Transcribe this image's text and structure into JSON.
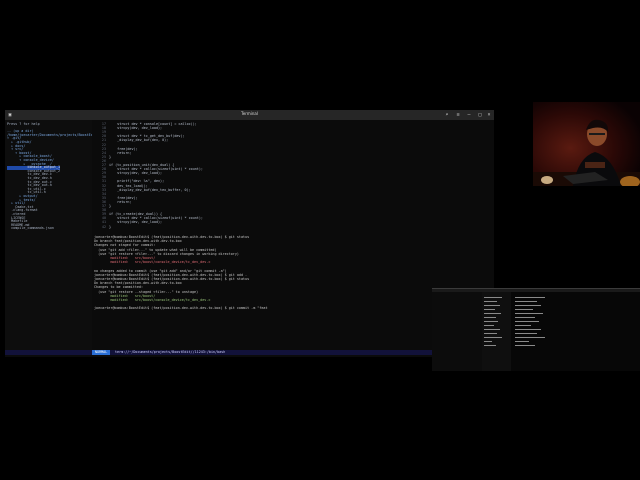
{
  "window": {
    "title": "Terminal"
  },
  "tree": {
    "items": [
      {
        "label": "Press ? for help",
        "kind": "file"
      },
      {
        "label": "",
        "kind": "file"
      },
      {
        "label": ".. (up a dir)",
        "kind": "dir"
      },
      {
        "label": "/home/joecarter/Documents/projects/BoostEdit/",
        "kind": "dir"
      },
      {
        "label": "▾ .git/",
        "kind": "dir"
      },
      {
        "label": "  ▸ .github/",
        "kind": "dir"
      },
      {
        "label": "  ▸ docs/",
        "kind": "dir"
      },
      {
        "label": "  ▾ src/",
        "kind": "dir"
      },
      {
        "label": "    ▾ boost/",
        "kind": "dir"
      },
      {
        "label": "      ▸ console_boost/",
        "kind": "dir"
      },
      {
        "label": "      ▾ console_device/",
        "kind": "dir"
      },
      {
        "label": "        ▸ __pycache__/",
        "kind": "dir"
      },
      {
        "label": "          console_output_1",
        "kind": "sel"
      },
      {
        "label": "          console_output_2",
        "kind": "file"
      },
      {
        "label": "          tc_dev_dev.c",
        "kind": "file"
      },
      {
        "label": "          tc_dev_dev.h",
        "kind": "file"
      },
      {
        "label": "          tc_dev_out.c",
        "kind": "file"
      },
      {
        "label": "          tc_dev_out.h",
        "kind": "file"
      },
      {
        "label": "          tc_util.c",
        "kind": "file"
      },
      {
        "label": "          tc_util.h",
        "kind": "file"
      },
      {
        "label": "      ▸ output/",
        "kind": "dir"
      },
      {
        "label": "      ▸ tests/",
        "kind": "dir"
      },
      {
        "label": "  ▸ util/",
        "kind": "dir"
      },
      {
        "label": "    Cmake.txt",
        "kind": "file"
      },
      {
        "label": "  .clang-format",
        "kind": "file"
      },
      {
        "label": "  .ctered",
        "kind": "file"
      },
      {
        "label": "  LICENSE",
        "kind": "file"
      },
      {
        "label": "  Makefile",
        "kind": "file"
      },
      {
        "label": "  README.md",
        "kind": "file"
      },
      {
        "label": "  compile_commands.json",
        "kind": "file"
      }
    ]
  },
  "editor": {
    "lines": [
      {
        "n": "17",
        "t": "    struct dev * console[count] = calloc();"
      },
      {
        "n": "18",
        "t": "    strcpy(dev, dev_load);"
      },
      {
        "n": "19",
        "t": ""
      },
      {
        "n": "20",
        "t": "    struct dev * tc_get_dev_buf(dev);"
      },
      {
        "n": "21",
        "t": "    _display_dev_buf(dev, 0);"
      },
      {
        "n": "22",
        "t": ""
      },
      {
        "n": "23",
        "t": "    free(dev);"
      },
      {
        "n": "24",
        "t": "    return;"
      },
      {
        "n": "25",
        "t": "}"
      },
      {
        "n": "26",
        "t": ""
      },
      {
        "n": "27",
        "t": "if (tc_position_unit(dev_dual) {"
      },
      {
        "n": "28",
        "t": "    struct dev * calloc(sizeof(uint) * count);"
      },
      {
        "n": "29",
        "t": "    strcpy(dev, dev_load);"
      },
      {
        "n": "30",
        "t": ""
      },
      {
        "n": "31",
        "t": "    printf(\"dev: %s\", dev);"
      },
      {
        "n": "32",
        "t": "    dev_tex_load();"
      },
      {
        "n": "33",
        "t": "    _display_dev_buf(dev_tex_buffer, 0);"
      },
      {
        "n": "34",
        "t": ""
      },
      {
        "n": "35",
        "t": "    free(dev);"
      },
      {
        "n": "36",
        "t": "    return;"
      },
      {
        "n": "37",
        "t": "}"
      },
      {
        "n": "38",
        "t": ""
      },
      {
        "n": "39",
        "t": "if (tc_create(dev_dual)) {"
      },
      {
        "n": "40",
        "t": "    struct dev * calloc(sizeof(uint) * count);"
      },
      {
        "n": "41",
        "t": "    strcpy(dev, dev_load);"
      },
      {
        "n": "42",
        "t": "}"
      }
    ]
  },
  "shell": {
    "lines": [
      {
        "t": "joecarter@bombus:BoostEdit$ (feat/position-dev-with-dev-to-box) $ git status",
        "c": ""
      },
      {
        "t": "On branch feat/position-dev-with-dev-to-box",
        "c": ""
      },
      {
        "t": "Changes not staged for commit:",
        "c": ""
      },
      {
        "t": "  (use \"git add <file>...\" to update what will be committed)",
        "c": ""
      },
      {
        "t": "  (use \"git restore <file>...\" to discard changes in working directory)",
        "c": ""
      },
      {
        "t": "        modified:   src/boost/",
        "c": "red"
      },
      {
        "t": "        modified:   src/boost/console_device/tc_dev_dev.c",
        "c": "red"
      },
      {
        "t": "",
        "c": ""
      },
      {
        "t": "no changes added to commit (use \"git add\" and/or \"git commit -a\")",
        "c": ""
      },
      {
        "t": "joecarter@bombus:BoostEdit$ (feat/position-dev-with-dev-to-box) $ git add .",
        "c": ""
      },
      {
        "t": "joecarter@bombus:BoostEdit$ (feat/position-dev-with-dev-to-box) $ git status",
        "c": ""
      },
      {
        "t": "On branch feat/position-dev-with-dev-to-box",
        "c": ""
      },
      {
        "t": "Changes to be committed:",
        "c": ""
      },
      {
        "t": "  (use \"git restore --staged <file>...\" to unstage)",
        "c": ""
      },
      {
        "t": "        modified:   src/boost/",
        "c": "green"
      },
      {
        "t": "        modified:   src/boost/console_device/tc_dev_dev.c",
        "c": "green"
      },
      {
        "t": "",
        "c": ""
      },
      {
        "t": "joecarter@bombus:BoostEdit$ (feat/position-dev-with-dev-to-box) $ git commit -m \"feat",
        "c": ""
      }
    ]
  },
  "status": {
    "mode": "NORMAL",
    "path": "term://~/Documents/projects/BoostEdit//11243:/bin/bash"
  },
  "icons": [
    "terminal-icon",
    "search-icon",
    "menu-icon",
    "minimize-icon",
    "maximize-icon",
    "close-icon"
  ]
}
